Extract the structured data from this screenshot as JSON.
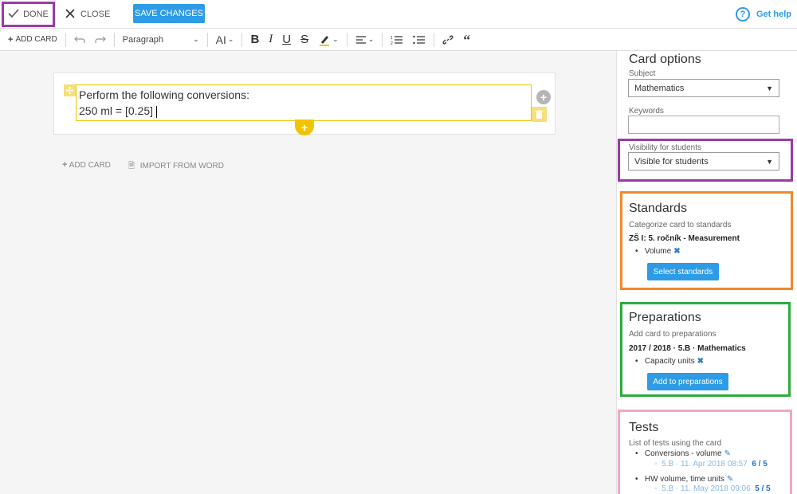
{
  "topbar": {
    "done_label": "DONE",
    "close_label": "CLOSE",
    "save_label": "SAVE CHANGES",
    "help_label": "Get help"
  },
  "toolbar": {
    "add_card_label": "ADD CARD",
    "paragraph_label": "Paragraph",
    "font_size_label": "AI"
  },
  "card": {
    "line1": "Perform the following conversions:",
    "line2": "250 ml = [0.25] "
  },
  "below": {
    "add_card": "ADD CARD",
    "import": "IMPORT FROM WORD"
  },
  "sidebar": {
    "title": "Card options",
    "subject_label": "Subject",
    "subject_value": "Mathematics",
    "keywords_label": "Keywords",
    "visibility_label": "Visibility for students",
    "visibility_value": "Visible for students",
    "standards": {
      "title": "Standards",
      "subtitle": "Categorize card to standards",
      "group": "ZŠ I: 5. ročník - Measurement",
      "items": [
        "Volume"
      ],
      "button": "Select standards"
    },
    "preparations": {
      "title": "Preparations",
      "subtitle": "Add card to preparations",
      "group": "2017 / 2018 · 5.B · Mathematics",
      "items": [
        "Capacity units"
      ],
      "button": "Add to preparations"
    },
    "tests": {
      "title": "Tests",
      "subtitle": "List of tests using the card",
      "items": [
        {
          "name": "Conversions - volume",
          "meta": "5.B · 11. Apr 2018 08:57",
          "score": "6 / 5"
        },
        {
          "name": "HW volume, time units",
          "meta": "5.B · 11. May 2018 09:06",
          "score": "5 / 5"
        }
      ]
    }
  },
  "colors": {
    "accent": "#2d9be6",
    "highlight_purple": "#9b3aa8",
    "highlight_orange": "#f08a2c",
    "highlight_green": "#2eaa3e",
    "highlight_pink": "#f4a5c5"
  }
}
